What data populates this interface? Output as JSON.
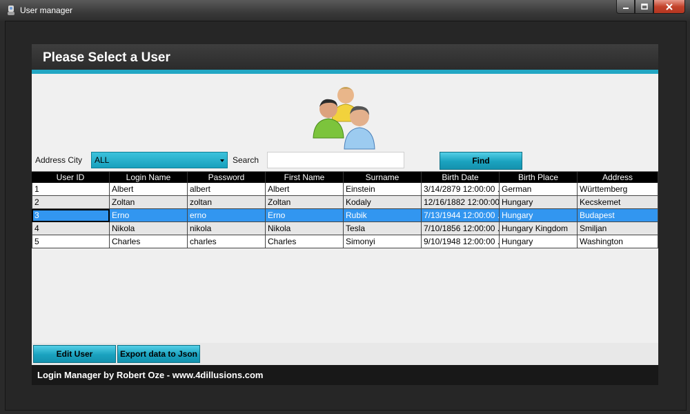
{
  "window": {
    "title": "User manager"
  },
  "header": {
    "title": "Please Select a User"
  },
  "filters": {
    "city_label": "Address City",
    "city_value": "ALL",
    "search_label": "Search",
    "search_value": "",
    "find_label": "Find"
  },
  "table": {
    "columns": [
      "User ID",
      "Login Name",
      "Password",
      "First Name",
      "Surname",
      "Birth Date",
      "Birth Place",
      "Address"
    ],
    "rows": [
      [
        "1",
        "Albert",
        "albert",
        "Albert",
        "Einstein",
        "3/14/2879 12:00:00 .",
        "German",
        "Württemberg"
      ],
      [
        "2",
        "Zoltan",
        "zoltan",
        "Zoltan",
        "Kodaly",
        "12/16/1882 12:00:00",
        "Hungary",
        "Kecskemet"
      ],
      [
        "3",
        "Erno",
        "erno",
        "Erno",
        "Rubik",
        "7/13/1944 12:00:00 .",
        "Hungary",
        "Budapest"
      ],
      [
        "4",
        "Nikola",
        "nikola",
        "Nikola",
        "Tesla",
        "7/10/1856 12:00:00 .",
        "Hungary Kingdom",
        "Smiljan"
      ],
      [
        "5",
        "Charles",
        "charles",
        "Charles",
        "Simonyi",
        "9/10/1948 12:00:00 .",
        "Hungary",
        "Washington"
      ]
    ],
    "selected_row": 2
  },
  "actions": {
    "edit_label": "Edit User",
    "export_label": "Export data to Json"
  },
  "footer": {
    "text": "Login Manager by Robert Oze - www.4dillusions.com"
  },
  "colors": {
    "accent": "#22a7c4",
    "selection": "#3296f0",
    "header_bg": "#2b2b2b"
  },
  "icons": [
    "app-icon",
    "minimize-icon",
    "maximize-icon",
    "close-icon",
    "users-group-icon",
    "dropdown-arrow-icon"
  ]
}
